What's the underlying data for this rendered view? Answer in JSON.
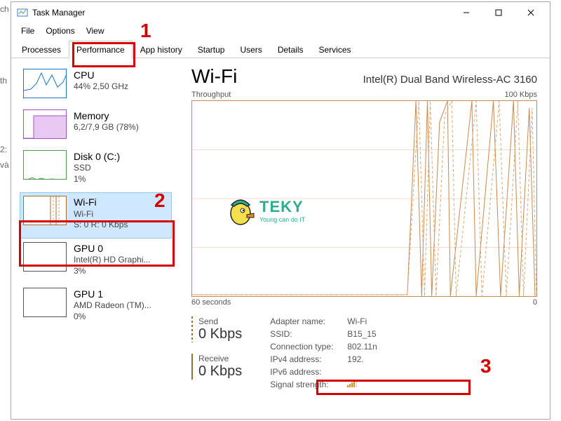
{
  "window": {
    "title": "Task Manager"
  },
  "menu": {
    "file": "File",
    "options": "Options",
    "view": "View"
  },
  "tabs": {
    "processes": "Processes",
    "performance": "Performance",
    "apphistory": "App history",
    "startup": "Startup",
    "users": "Users",
    "details": "Details",
    "services": "Services"
  },
  "side": {
    "cpu": {
      "title": "CPU",
      "l1": "44% 2,50 GHz"
    },
    "mem": {
      "title": "Memory",
      "l1": "6,2/7,9 GB (78%)"
    },
    "disk": {
      "title": "Disk 0 (C:)",
      "l1": "SSD",
      "l2": "1%"
    },
    "wifi": {
      "title": "Wi-Fi",
      "l1": "Wi-Fi",
      "l2": "S: 0 R: 0 Kbps"
    },
    "gpu0": {
      "title": "GPU 0",
      "l1": "Intel(R) HD Graphi...",
      "l2": "3%"
    },
    "gpu1": {
      "title": "GPU 1",
      "l1": "AMD Radeon (TM)...",
      "l2": "0%"
    }
  },
  "main": {
    "name": "Wi-Fi",
    "adapter": "Intel(R) Dual Band Wireless-AC 3160",
    "chart_label": "Throughput",
    "max_label": "100 Kbps",
    "x_left": "60 seconds",
    "x_right": "0",
    "send_label": "Send",
    "send_value": "0 Kbps",
    "recv_label": "Receive",
    "recv_value": "0 Kbps",
    "props": {
      "adapter_k": "Adapter name:",
      "adapter_v": "Wi-Fi",
      "ssid_k": "SSID:",
      "ssid_v": "B15_15",
      "conn_k": "Connection type:",
      "conn_v": "802.11n",
      "ipv4_k": "IPv4 address:",
      "ipv4_v": "192.",
      "ipv6_k": "IPv6 address:",
      "ipv6_v": "",
      "sig_k": "Signal strength:"
    }
  },
  "ann": {
    "n1": "1",
    "n2": "2",
    "n3": "3"
  },
  "watermark": {
    "name": "TEKY",
    "tag": "Young can do IT"
  },
  "edge": {
    "ch": "ch",
    "th": "th",
    "t2": "2:",
    "va": "và"
  }
}
